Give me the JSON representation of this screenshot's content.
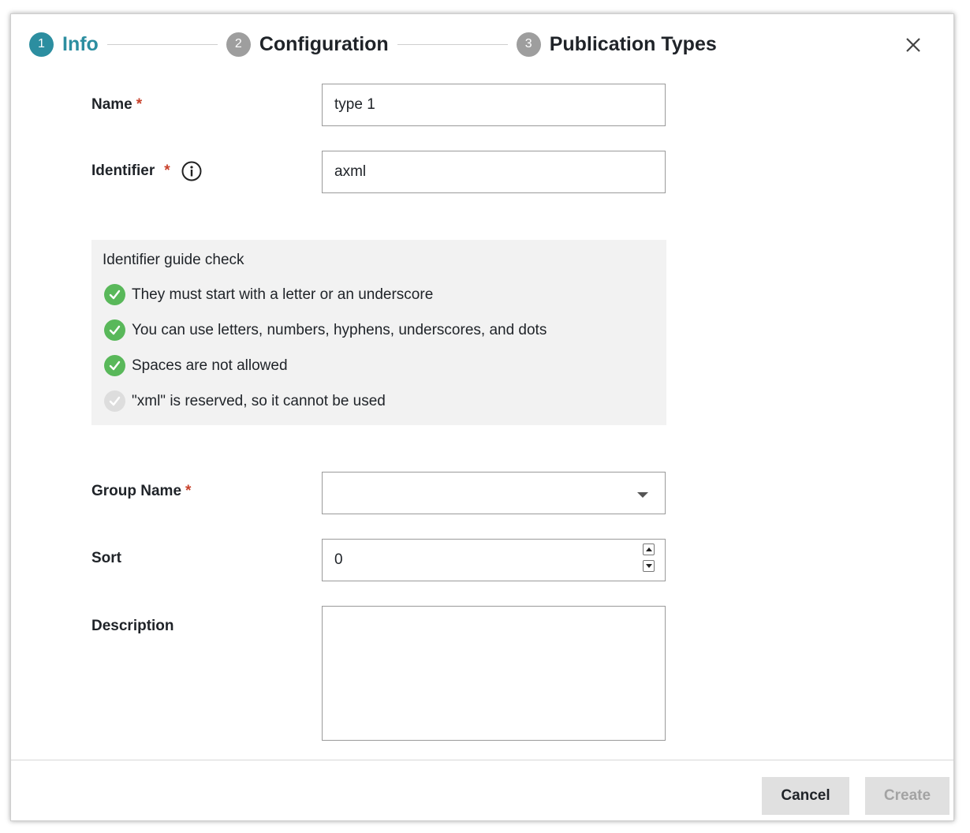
{
  "stepper": {
    "steps": [
      {
        "number": "1",
        "label": "Info"
      },
      {
        "number": "2",
        "label": "Configuration"
      },
      {
        "number": "3",
        "label": "Publication Types"
      }
    ]
  },
  "form": {
    "name": {
      "label": "Name",
      "required": "*",
      "value": "type 1"
    },
    "identifier": {
      "label": "Identifier",
      "required": "*",
      "value": "axml"
    },
    "group_name": {
      "label": "Group Name",
      "required": "*",
      "value": ""
    },
    "sort": {
      "label": "Sort",
      "value": "0"
    },
    "description": {
      "label": "Description",
      "value": ""
    }
  },
  "guide": {
    "title": "Identifier guide check",
    "rules": [
      {
        "text": "They must start with a letter or an underscore",
        "passed": true
      },
      {
        "text": "You can use letters, numbers, hyphens, underscores, and dots",
        "passed": true
      },
      {
        "text": "Spaces are not allowed",
        "passed": true
      },
      {
        "text": "\"xml\" is reserved, so it cannot be used",
        "passed": false
      }
    ]
  },
  "footer": {
    "cancel_label": "Cancel",
    "create_label": "Create"
  },
  "colors": {
    "accent": "#2c8ea0",
    "check_passed": "#59b85a",
    "check_pending": "#dddddd",
    "required": "#c8412b"
  }
}
